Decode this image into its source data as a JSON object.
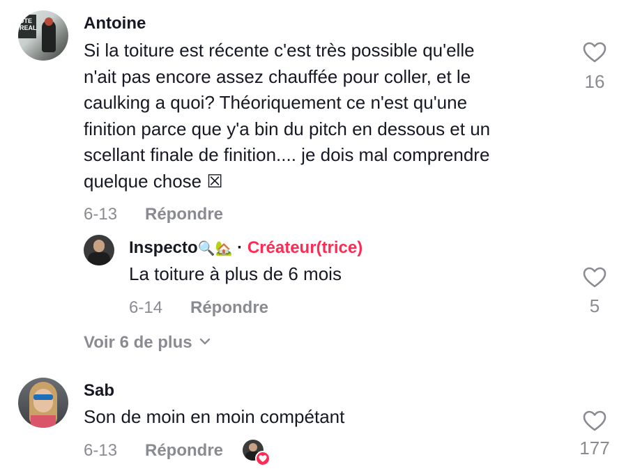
{
  "comments": [
    {
      "username": "Antoine",
      "avatar_text": "UTE\nREAL",
      "text_lines": [
        "Si la toiture est récente c'est très possible qu'elle",
        "n'ait pas encore assez chauffée pour coller, et le",
        "caulking a quoi? Théoriquement ce n'est qu'une",
        "finition parce que y'a bin du pitch en dessous et un",
        "scellant finale de finition.... je dois mal comprendre",
        "quelque chose ☒"
      ],
      "date": "6-13",
      "reply_label": "Répondre",
      "likes": "16",
      "reply": {
        "username": "Inspecto",
        "username_emoji": "🔍🏡",
        "separator": "·",
        "creator_label": "Créateur(trice)",
        "text": "La toiture à plus de 6 mois",
        "date": "6-14",
        "reply_label": "Répondre",
        "likes": "5"
      },
      "more_replies_label": "Voir 6 de plus"
    },
    {
      "username": "Sab",
      "text": "Son de moin en moin compétant",
      "date": "6-13",
      "reply_label": "Répondre",
      "likes": "177"
    }
  ],
  "colors": {
    "text": "#161823",
    "muted": "#8a8b91",
    "creator": "#fe2c55",
    "liked_by_creator": "#fe2c55"
  },
  "icons": [
    "heart-outline-icon",
    "chevron-down-icon",
    "heart-badge-icon"
  ]
}
